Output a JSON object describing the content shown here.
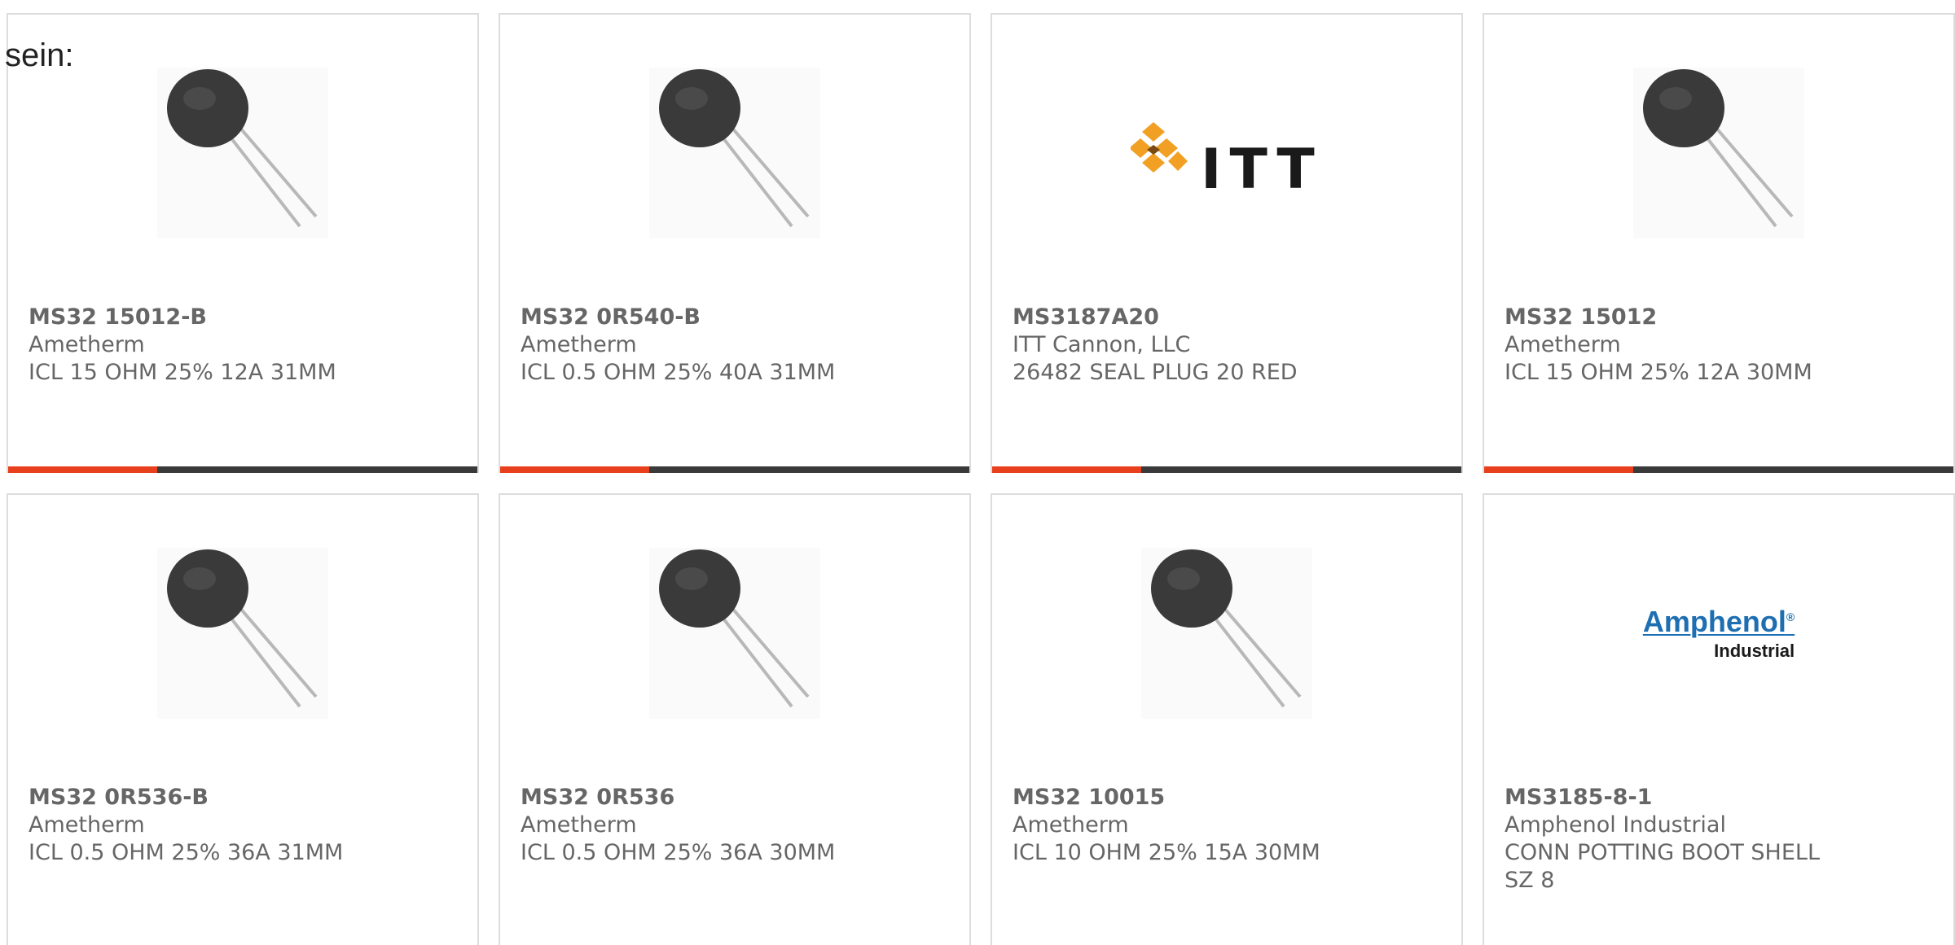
{
  "intro_text": "sein:",
  "colors": {
    "accent": "#e8401c",
    "bar": "#3a3a3a",
    "text": "#666666",
    "itt_orange": "#f2a023",
    "amphenol_blue": "#1e6fb2"
  },
  "products": [
    {
      "part_number": "MS32 15012-B",
      "manufacturer": "Ametherm",
      "description": "ICL 15 OHM 25% 12A 31MM",
      "image": "thermistor"
    },
    {
      "part_number": "MS32 0R540-B",
      "manufacturer": "Ametherm",
      "description": "ICL 0.5 OHM 25% 40A 31MM",
      "image": "thermistor"
    },
    {
      "part_number": "MS3187A20",
      "manufacturer": "ITT Cannon, LLC",
      "description": "26482 SEAL PLUG 20 RED",
      "image": "itt-logo",
      "logo_text": "ITT"
    },
    {
      "part_number": "MS32 15012",
      "manufacturer": "Ametherm",
      "description": "ICL 15 OHM 25% 12A 30MM",
      "image": "thermistor"
    },
    {
      "part_number": "MS32 0R536-B",
      "manufacturer": "Ametherm",
      "description": "ICL 0.5 OHM 25% 36A 31MM",
      "image": "thermistor"
    },
    {
      "part_number": "MS32 0R536",
      "manufacturer": "Ametherm",
      "description": "ICL 0.5 OHM 25% 36A 30MM",
      "image": "thermistor"
    },
    {
      "part_number": "MS32 10015",
      "manufacturer": "Ametherm",
      "description": "ICL 10 OHM 25% 15A 30MM",
      "image": "thermistor"
    },
    {
      "part_number": "MS3185-8-1",
      "manufacturer": "Amphenol Industrial",
      "description": "CONN POTTING BOOT SHELL SZ 8",
      "image": "amphenol-logo",
      "logo_text": "Amphenol",
      "logo_subtext": "Industrial"
    }
  ]
}
